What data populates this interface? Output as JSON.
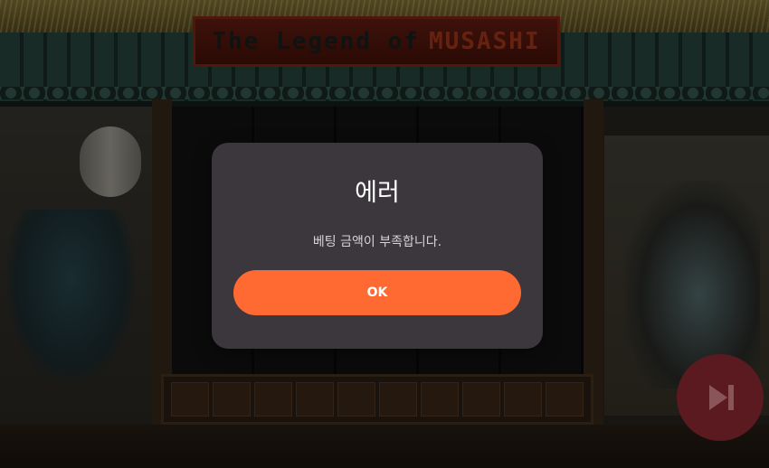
{
  "game": {
    "title_part1": "The Legend of",
    "title_part2": "MUSASHI"
  },
  "dialog": {
    "title": "에러",
    "message": "베팅 금액이 부족합니다.",
    "ok_label": "OK"
  },
  "controls": {
    "skip_icon": "skip-forward-icon"
  },
  "colors": {
    "dialog_bg": "#3b373d",
    "ok_button": "#ff6a32",
    "skip_button": "#5a1a1f"
  }
}
